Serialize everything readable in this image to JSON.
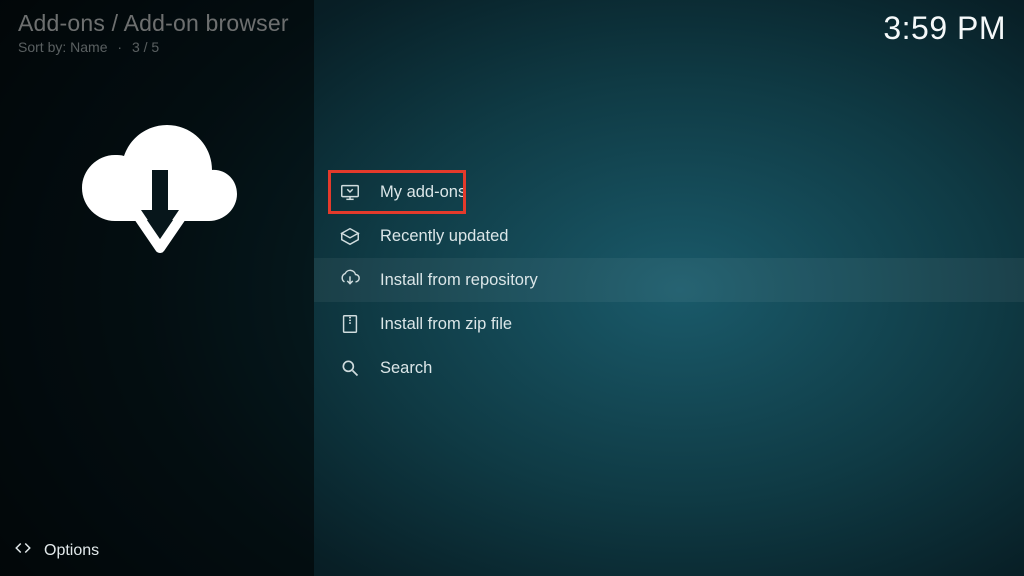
{
  "header": {
    "breadcrumb": "Add-ons / Add-on browser",
    "sort_label": "Sort by: Name",
    "position": "3 / 5",
    "clock": "3:59 PM"
  },
  "sidebar": {
    "options_label": "Options"
  },
  "menu": {
    "items": [
      {
        "icon": "monitor-icon",
        "label": "My add-ons",
        "selected": false,
        "highlighted": true
      },
      {
        "icon": "box-open-icon",
        "label": "Recently updated",
        "selected": false
      },
      {
        "icon": "cloud-down-icon",
        "label": "Install from repository",
        "selected": true
      },
      {
        "icon": "zip-file-icon",
        "label": "Install from zip file",
        "selected": false
      },
      {
        "icon": "search-icon",
        "label": "Search",
        "selected": false
      }
    ]
  }
}
